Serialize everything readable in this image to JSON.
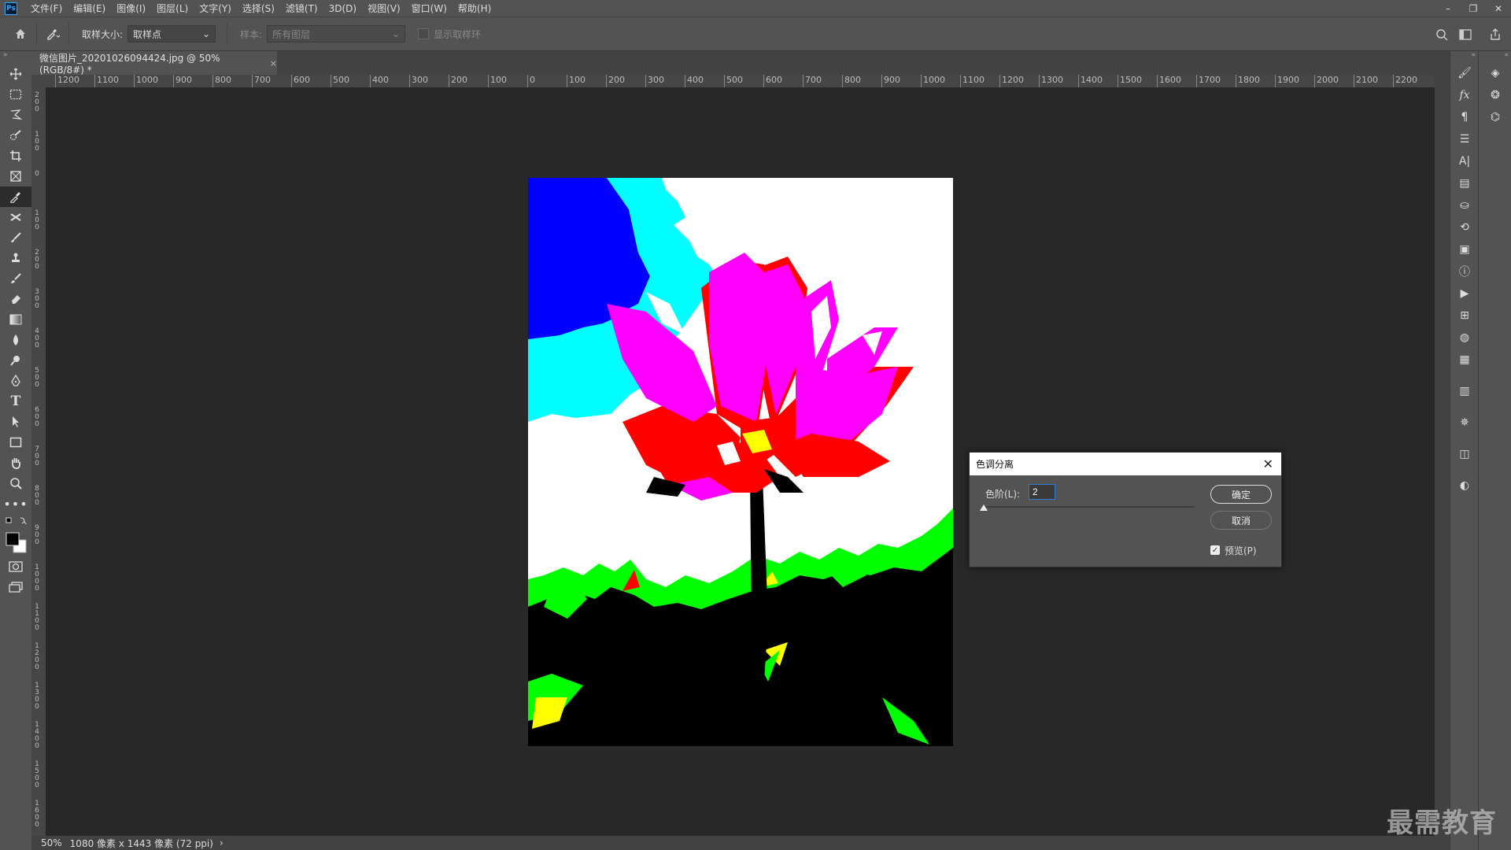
{
  "menubar": {
    "logo": "Ps",
    "items": [
      "文件(F)",
      "编辑(E)",
      "图像(I)",
      "图层(L)",
      "文字(Y)",
      "选择(S)",
      "滤镜(T)",
      "3D(D)",
      "视图(V)",
      "窗口(W)",
      "帮助(H)"
    ],
    "minimize": "–",
    "restore": "❐",
    "close": "✕"
  },
  "options": {
    "sample_size_label": "取样大小:",
    "sample_size_value": "取样点",
    "sample_label": "样本:",
    "sample_value": "所有图层",
    "show_ring_label": "显示取样环"
  },
  "document": {
    "tab_title": "微信图片_20201026094424.jpg @ 50%(RGB/8#) *",
    "tab_close": "×"
  },
  "ruler": {
    "h_ticks": [
      "1200",
      "1100",
      "1000",
      "900",
      "800",
      "700",
      "600",
      "500",
      "400",
      "300",
      "200",
      "100",
      "0",
      "100",
      "200",
      "300",
      "400",
      "500",
      "600",
      "700",
      "800",
      "900",
      "1000",
      "1100",
      "1200",
      "1300",
      "1400",
      "1500",
      "1600",
      "1700",
      "1800",
      "1900",
      "2000",
      "2100",
      "2200"
    ],
    "v_ticks": [
      "2",
      "1",
      "0",
      "1",
      "2",
      "3",
      "4",
      "5",
      "6",
      "7",
      "8",
      "9",
      "10",
      "11",
      "12",
      "13",
      "14",
      "15",
      "16"
    ]
  },
  "status": {
    "zoom": "50%",
    "dimensions": "1080 像素 x 1443 像素 (72 ppi)"
  },
  "dialog": {
    "title": "色调分离",
    "levels_label": "色阶(L):",
    "levels_value": "2",
    "ok_label": "确定",
    "cancel_label": "取消",
    "preview_label": "预览(P)",
    "preview_checked": true
  },
  "watermark": "最需教育",
  "colors": {
    "ui_panel": "#535353",
    "canvas_bg": "#282828",
    "accent_input": "#2e7bd6"
  }
}
